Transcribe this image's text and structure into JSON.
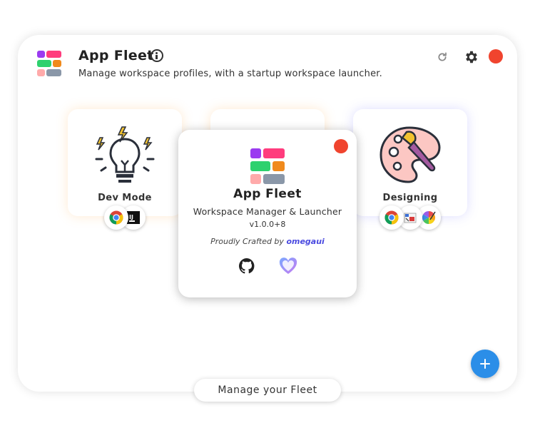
{
  "header": {
    "title": "App Fleet",
    "subtitle": "Manage workspace profiles, with a startup workspace launcher."
  },
  "colors": {
    "accent": "#2b8ee8",
    "close": "#f0442e",
    "logo": [
      "#9b3bf0",
      "#ff3c7d",
      "#2ed16e",
      "#f08a1c",
      "#ffaaaa",
      "#8a97a8"
    ]
  },
  "fleets": [
    {
      "label": "Dev Mode",
      "icon": "lightbulb-icon",
      "apps": [
        "chrome-icon",
        "intellij-icon"
      ]
    },
    {
      "label": "",
      "icon": "",
      "apps": []
    },
    {
      "label": "Designing",
      "icon": "palette-icon",
      "apps": [
        "chrome-icon",
        "paint-icon",
        "color-wheel-icon"
      ]
    }
  ],
  "about": {
    "title": "App Fleet",
    "description": "Workspace Manager & Launcher",
    "version": "v1.0.0+8",
    "credit_prefix": "Proudly Crafted by",
    "credit_author": "omegaui"
  },
  "footer": {
    "manage_label": "Manage your Fleet"
  }
}
